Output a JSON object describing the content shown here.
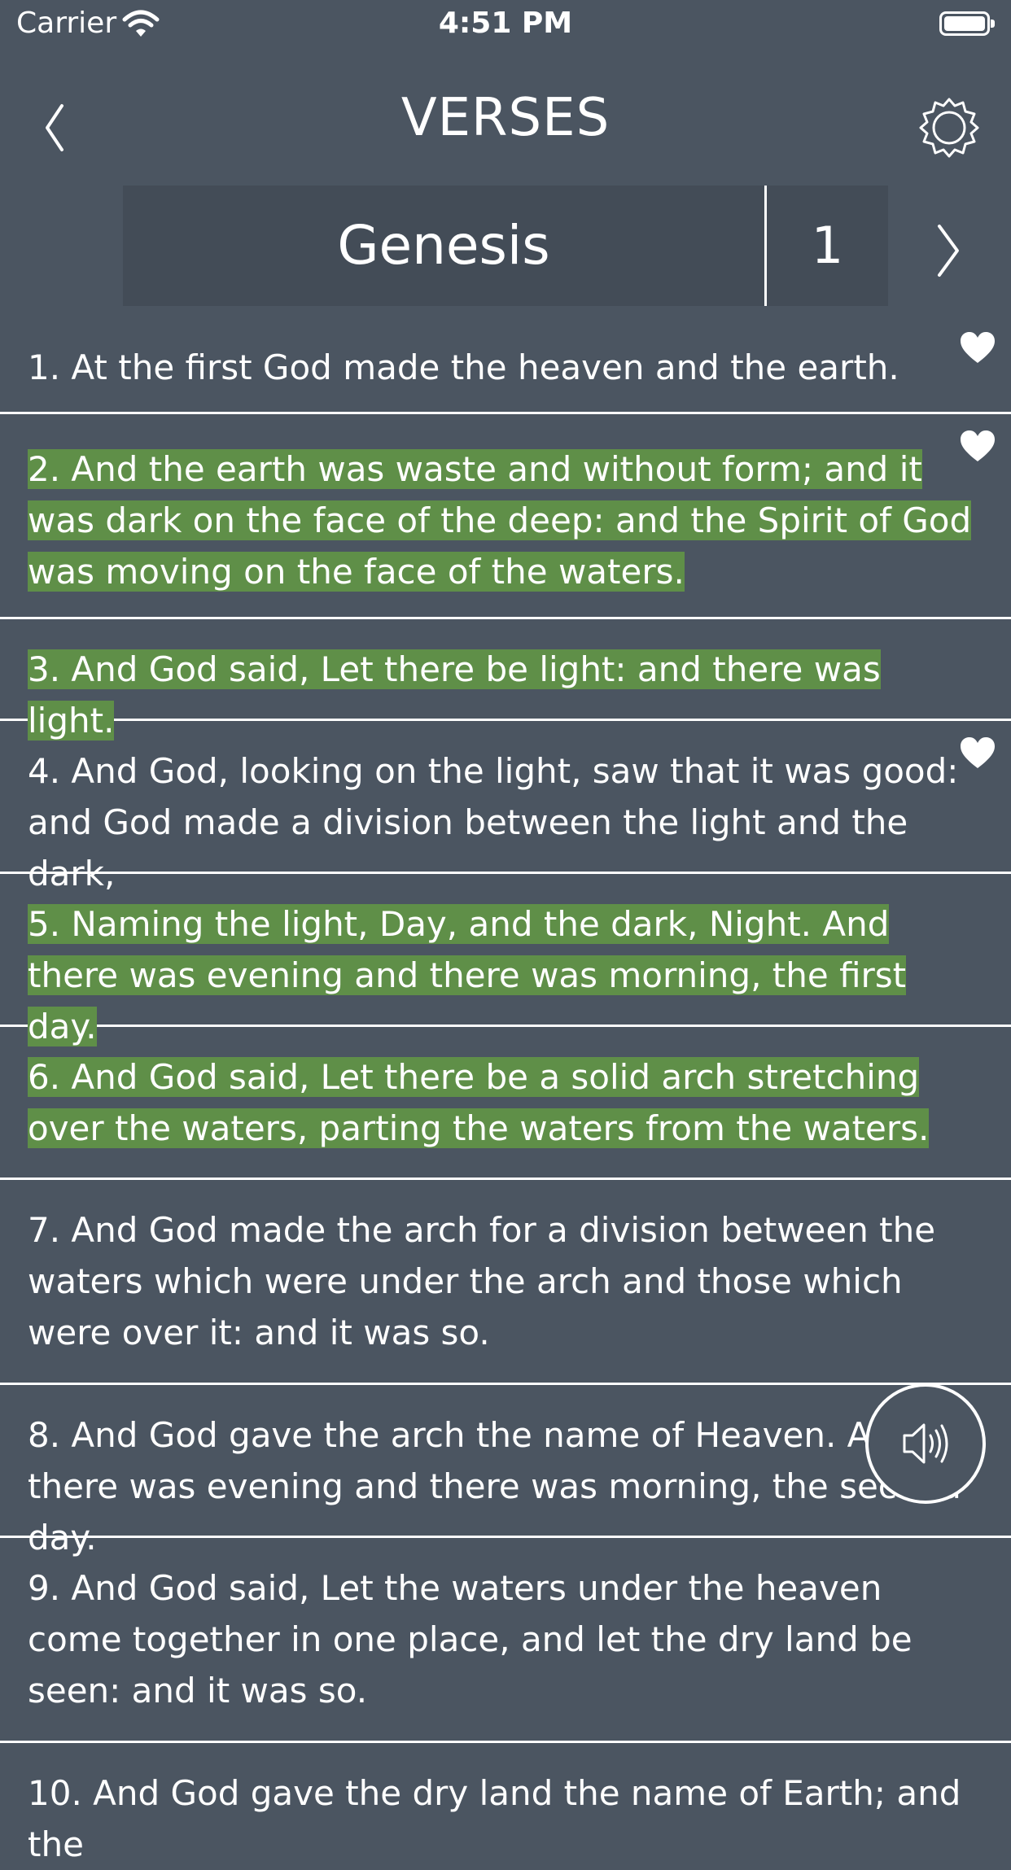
{
  "status_bar": {
    "carrier": "Carrier",
    "time": "4:51 PM"
  },
  "header": {
    "title": "VERSES",
    "back_icon": "chevron-left-icon",
    "settings_icon": "gear-icon"
  },
  "selector": {
    "book": "Genesis",
    "chapter": "1",
    "next_icon": "chevron-right-icon"
  },
  "colors": {
    "background": "#4b5561",
    "highlight": "#5f8f48",
    "selector_bg": "#434c57",
    "text": "#ffffff"
  },
  "verses": [
    {
      "text": "1. At the first God made the heaven and the earth.",
      "highlighted": false,
      "favorite": true
    },
    {
      "text": "2. And the earth was waste and without form; and it was dark on the face of the deep: and the Spirit of God was moving on the face of the waters.",
      "highlighted": true,
      "favorite": true
    },
    {
      "text": "3. And God said, Let there be light: and there was light.",
      "highlighted": true,
      "favorite": false
    },
    {
      "text": "4. And God, looking on the light, saw that it was good: and God made a division between the light and the dark,",
      "highlighted": false,
      "favorite": true
    },
    {
      "text": "5. Naming the light, Day, and the dark, Night. And there was evening and there was morning, the first day.",
      "highlighted": true,
      "favorite": false
    },
    {
      "text": "6. And God said, Let there be a solid arch stretching over the waters, parting the waters from the waters.",
      "highlighted": true,
      "favorite": false
    },
    {
      "text": "7. And God made the arch for a division between the waters which were under the arch and those which were over it: and it was so.",
      "highlighted": false,
      "favorite": false
    },
    {
      "text": "8. And God gave the arch the name of Heaven. And there was evening and there was morning, the second day.",
      "highlighted": false,
      "favorite": false
    },
    {
      "text": "9. And God said, Let the waters under the heaven come together in one place, and let the dry land be seen: and it was so.",
      "highlighted": false,
      "favorite": false
    },
    {
      "text": "10. And God gave the dry land the name of Earth; and the",
      "highlighted": false,
      "favorite": false
    }
  ],
  "audio_button": {
    "icon": "speaker-icon"
  }
}
